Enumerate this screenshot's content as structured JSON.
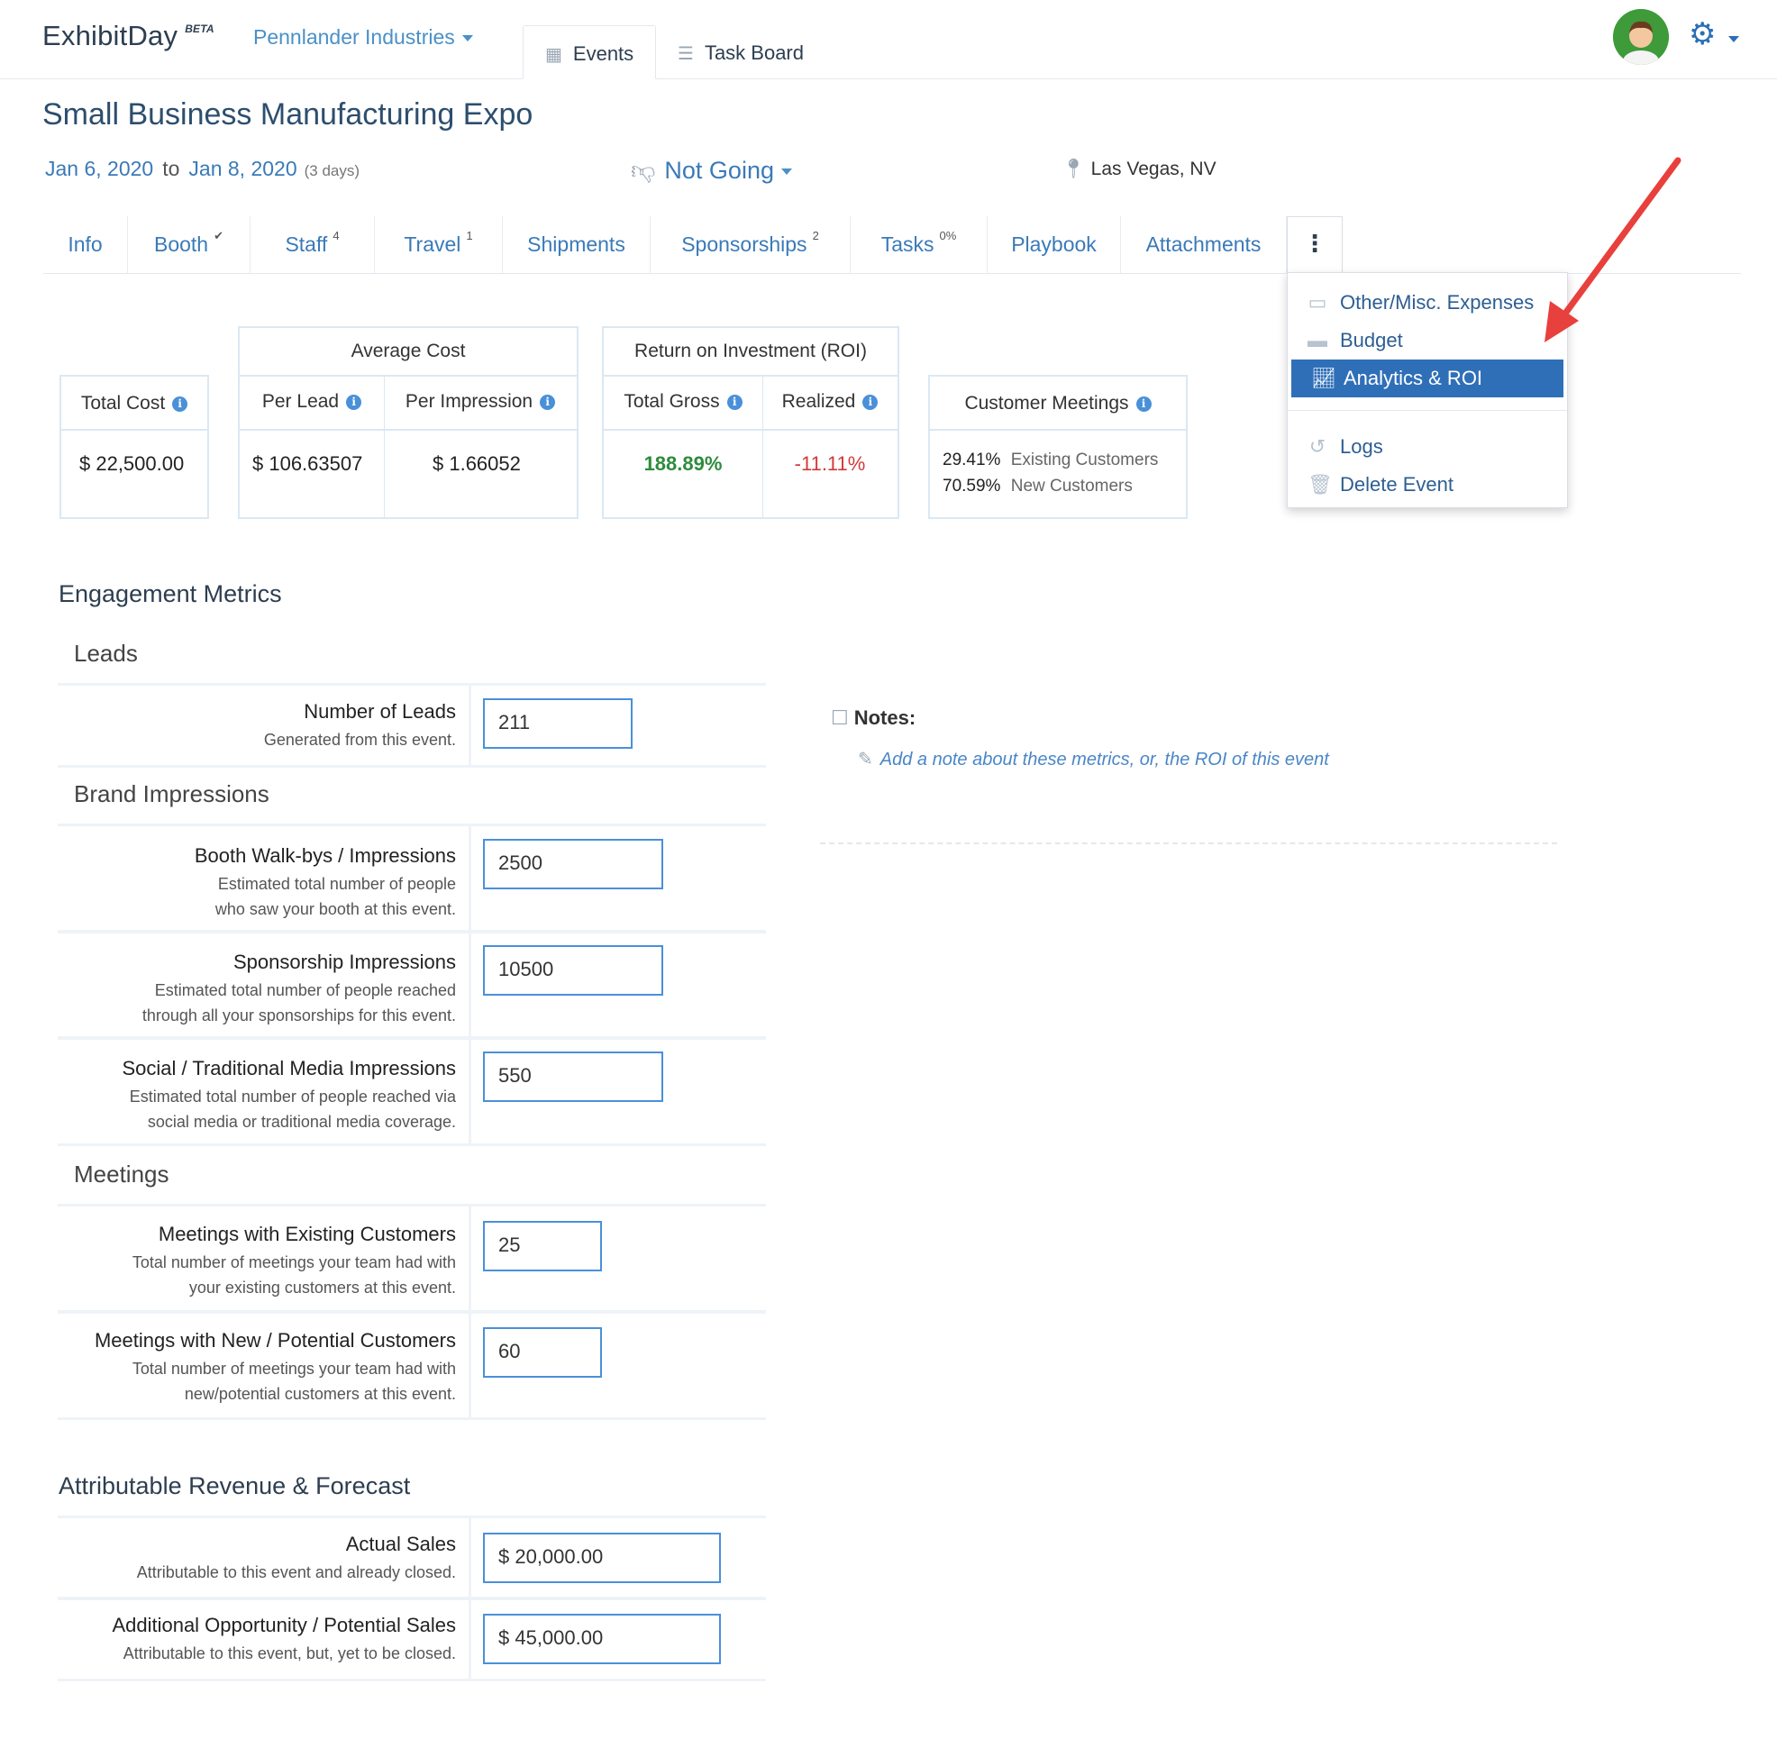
{
  "app": {
    "logo": "ExhibitDay",
    "logo_badge": "BETA",
    "org": "Pennlander Industries",
    "nav_tabs": [
      {
        "label": "Events",
        "icon": "calendar-icon"
      },
      {
        "label": "Task Board",
        "icon": "checklist-icon"
      }
    ]
  },
  "event": {
    "title": "Small Business Manufacturing Expo",
    "start": "Jan 6, 2020",
    "to": "to",
    "end": "Jan 8, 2020",
    "days": "(3 days)",
    "status": "Not Going",
    "location": "Las Vegas, NV"
  },
  "subtabs": [
    {
      "label": "Info",
      "badge": ""
    },
    {
      "label": "Booth",
      "badge": "✔"
    },
    {
      "label": "Staff",
      "badge": "4"
    },
    {
      "label": "Travel",
      "badge": "1"
    },
    {
      "label": "Shipments",
      "badge": ""
    },
    {
      "label": "Sponsorships",
      "badge": "2"
    },
    {
      "label": "Tasks",
      "badge": "0%"
    },
    {
      "label": "Playbook",
      "badge": ""
    },
    {
      "label": "Attachments",
      "badge": ""
    }
  ],
  "menu": {
    "items": [
      {
        "label": "Other/Misc. Expenses",
        "icon": "money-icon"
      },
      {
        "label": "Budget",
        "icon": "cash-icon"
      },
      {
        "label": "Analytics & ROI",
        "icon": "chart-icon",
        "active": true
      },
      {
        "label": "Logs",
        "icon": "history-icon"
      },
      {
        "label": "Delete Event",
        "icon": "trash-icon"
      }
    ]
  },
  "stats": {
    "total_cost": {
      "label": "Total Cost",
      "value": "$ 22,500.00"
    },
    "average_cost": {
      "title": "Average Cost",
      "per_lead_label": "Per Lead",
      "per_lead": "$ 106.63507",
      "per_impression_label": "Per Impression",
      "per_impression": "$ 1.66052"
    },
    "roi": {
      "title": "Return on Investment (ROI)",
      "total_gross_label": "Total Gross",
      "total_gross": "188.89%",
      "realized_label": "Realized",
      "realized": "-11.11%"
    },
    "meetings": {
      "label": "Customer Meetings",
      "existing_pct": "29.41%",
      "existing_label": "Existing Customers",
      "new_pct": "70.59%",
      "new_label": "New Customers"
    }
  },
  "engagement": {
    "title": "Engagement Metrics",
    "leads_title": "Leads",
    "leads": [
      {
        "label": "Number of Leads",
        "desc1": "Generated from this event.",
        "desc2": "",
        "value": "211"
      }
    ],
    "brand_title": "Brand Impressions",
    "brand": [
      {
        "label": "Booth Walk-bys / Impressions",
        "desc1": "Estimated total number of people",
        "desc2": "who saw your booth at this event.",
        "value": "2500"
      },
      {
        "label": "Sponsorship Impressions",
        "desc1": "Estimated total number of people reached",
        "desc2": "through all your sponsorships for this event.",
        "value": "10500"
      },
      {
        "label": "Social / Traditional Media Impressions",
        "desc1": "Estimated total number of people reached via",
        "desc2": "social media or traditional media coverage.",
        "value": "550"
      }
    ],
    "meetings_title": "Meetings",
    "meetings": [
      {
        "label": "Meetings with Existing Customers",
        "desc1": "Total number of meetings your team had with",
        "desc2": "your existing customers at this event.",
        "value": "25"
      },
      {
        "label": "Meetings with New / Potential Customers",
        "desc1": "Total number of meetings your team had with",
        "desc2": "new/potential customers at this event.",
        "value": "60"
      }
    ]
  },
  "revenue": {
    "title": "Attributable Revenue & Forecast",
    "rows": [
      {
        "label": "Actual Sales",
        "desc1": "Attributable to this event and already closed.",
        "value": "$ 20,000.00"
      },
      {
        "label": "Additional Opportunity / Potential Sales",
        "desc1": "Attributable to this event, but, yet to be closed.",
        "value": "$ 45,000.00"
      }
    ]
  },
  "notes": {
    "label": "Notes:",
    "placeholder": "Add a note about these metrics, or, the ROI of this event"
  }
}
